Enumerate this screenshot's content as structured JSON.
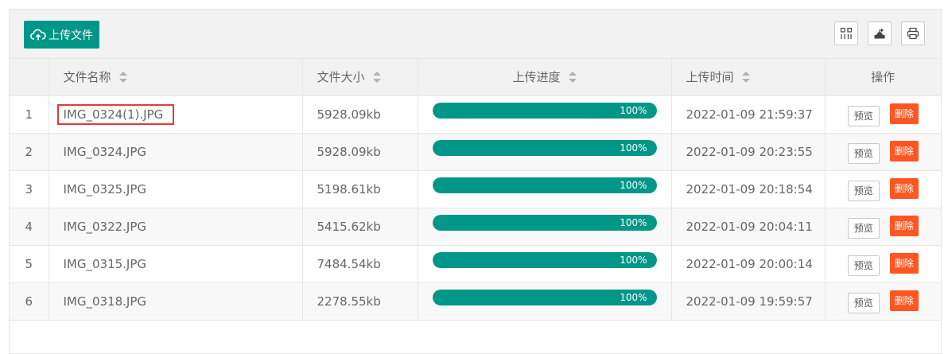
{
  "toolbar": {
    "upload_label": "上传文件",
    "upload_icon": "cloud-upload-icon",
    "tool_icons": [
      "columns-icon",
      "export-icon",
      "print-icon"
    ]
  },
  "table": {
    "headers": {
      "name": "文件名称",
      "size": "文件大小",
      "progress": "上传进度",
      "time": "上传时间",
      "ops": "操作"
    },
    "rows": [
      {
        "index": "1",
        "name": "IMG_0324(1).JPG",
        "size": "5928.09kb",
        "progress": 1.0,
        "progress_label": "100%",
        "time": "2022-01-09 21:59:37",
        "preview": "预览",
        "delete": "删除"
      },
      {
        "index": "2",
        "name": "IMG_0324.JPG",
        "size": "5928.09kb",
        "progress": 1.0,
        "progress_label": "100%",
        "time": "2022-01-09 20:23:55",
        "preview": "预览",
        "delete": "删除"
      },
      {
        "index": "3",
        "name": "IMG_0325.JPG",
        "size": "5198.61kb",
        "progress": 1.0,
        "progress_label": "100%",
        "time": "2022-01-09 20:18:54",
        "preview": "预览",
        "delete": "删除"
      },
      {
        "index": "4",
        "name": "IMG_0322.JPG",
        "size": "5415.62kb",
        "progress": 1.0,
        "progress_label": "100%",
        "time": "2022-01-09 20:04:11",
        "preview": "预览",
        "delete": "删除"
      },
      {
        "index": "5",
        "name": "IMG_0315.JPG",
        "size": "7484.54kb",
        "progress": 1.0,
        "progress_label": "100%",
        "time": "2022-01-09 20:00:14",
        "preview": "预览",
        "delete": "删除"
      },
      {
        "index": "6",
        "name": "IMG_0318.JPG",
        "size": "2278.55kb",
        "progress": 1.0,
        "progress_label": "100%",
        "time": "2022-01-09 19:59:57",
        "preview": "预览",
        "delete": "删除"
      }
    ]
  },
  "colors": {
    "primary": "#009688",
    "danger": "#ff5722",
    "highlight": "#e53935"
  }
}
